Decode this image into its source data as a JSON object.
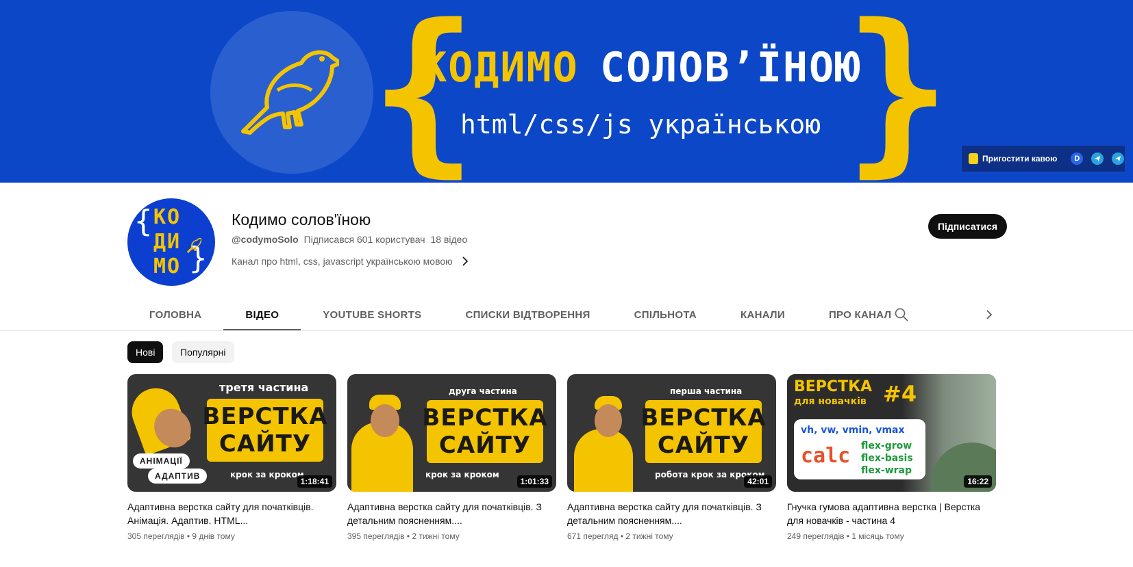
{
  "banner": {
    "title_yellow": "КОДИМО",
    "title_white": "СОЛОВ’ЇНОЮ",
    "subtitle": "html/css/js українською",
    "brace_left": "{",
    "brace_right": "}",
    "link_label": "Пригостити кавою",
    "link_icons": [
      "coffee-icon",
      "d-icon",
      "telegram-icon",
      "telegram-icon"
    ],
    "link_d": "D"
  },
  "channel": {
    "avatar_text": "КОДИМО",
    "avatar_lines": [
      "КО",
      "ДИ",
      "МО"
    ],
    "name": "Кодимо солов'їною",
    "handle": "@codymoSolo",
    "subscribers": "Підписався 601 користувач",
    "video_count": "18 відео",
    "description": "Канал про html, css, javascript українською мовою",
    "subscribe_label": "Підписатися"
  },
  "tabs": [
    {
      "label": "ГОЛОВНА",
      "active": false
    },
    {
      "label": "ВІДЕО",
      "active": true
    },
    {
      "label": "YOUTUBE SHORTS",
      "active": false
    },
    {
      "label": "СПИСКИ ВІДТВОРЕННЯ",
      "active": false
    },
    {
      "label": "СПІЛЬНОТА",
      "active": false
    },
    {
      "label": "КАНАЛИ",
      "active": false
    },
    {
      "label": "ПРО КАНАЛ",
      "active": false
    }
  ],
  "chips": [
    {
      "label": "Нові",
      "active": true
    },
    {
      "label": "Популярні",
      "active": false
    }
  ],
  "videos": [
    {
      "thumb_top": "третя частина",
      "thumb_l1": "ВЕРСТКА",
      "thumb_l2": "САЙТУ",
      "thumb_bottom": "крок за кроком",
      "pill1": "АНІМАЦІЇ",
      "pill2": "АДАПТИВ",
      "duration": "1:18:41",
      "title": "Адаптивна верстка сайту для початківців. Анімація. Адаптив. HTML...",
      "views": "305 переглядів",
      "age": "9 днів тому"
    },
    {
      "thumb_top": "друга частина",
      "thumb_l1": "ВЕРСТКА",
      "thumb_l2": "САЙТУ",
      "thumb_bottom": "крок за кроком",
      "duration": "1:01:33",
      "title": "Адаптивна верстка сайту для початківців. З детальним поясненням....",
      "views": "395 переглядів",
      "age": "2 тижні тому"
    },
    {
      "thumb_top": "перша частина",
      "thumb_l1": "ВЕРСТКА",
      "thumb_l2": "САЙТУ",
      "thumb_bottom": "робота крок за кроком",
      "duration": "42:01",
      "title": "Адаптивна верстка сайту для початківців. З детальним поясненням....",
      "views": "671 перегляд",
      "age": "2 тижні тому"
    },
    {
      "thumb_title": "ВЕРСТКА",
      "thumb_sub": "для новачків",
      "thumb_num": "#4",
      "thumb_units": "vh, vw, vmin, vmax",
      "thumb_calc": "calc",
      "thumb_flex": [
        "flex-grow",
        "flex-basis",
        "flex-wrap"
      ],
      "duration": "16:22",
      "title": "Гнучка гумова адаптивна верстка | Верстка для новачків - частина 4",
      "views": "249 переглядів",
      "age": "1 місяць тому"
    }
  ],
  "meta_separator": "•",
  "colors": {
    "banner_bg": "#0c47c8",
    "accent_yellow": "#f5c400",
    "subscribe_bg": "#0f0f0f"
  }
}
